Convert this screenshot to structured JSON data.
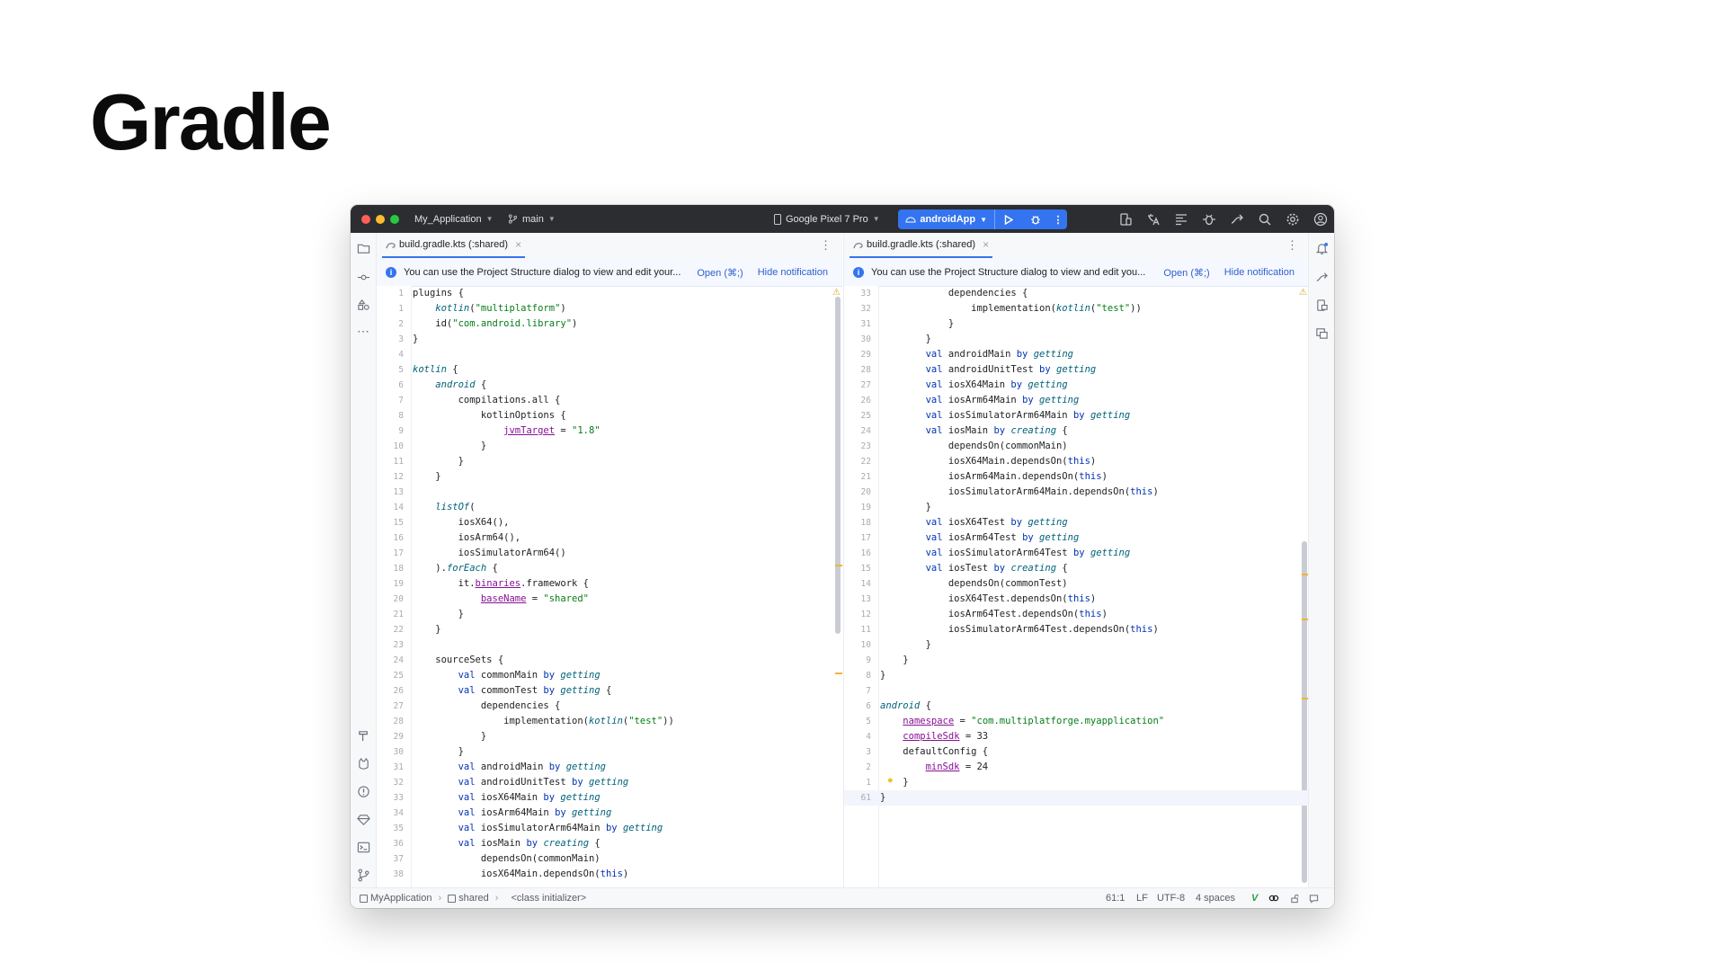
{
  "slide": {
    "title": "Gradle"
  },
  "titlebar": {
    "project": "My_Application",
    "branch": "main",
    "device": "Google Pixel 7 Pro",
    "run_config": "androidApp"
  },
  "left_pane": {
    "tab_label": "build.gradle.kts (:shared)",
    "notification": "You can use the Project Structure dialog to view and edit your...",
    "notification_open": "Open (⌘;)",
    "notification_hide": "Hide notification",
    "lines": [
      {
        "n": "1",
        "t": "plugins {"
      },
      {
        "n": "1",
        "t": "    kotlin(\"multiplatform\")"
      },
      {
        "n": "2",
        "t": "    id(\"com.android.library\")"
      },
      {
        "n": "3",
        "t": "}"
      },
      {
        "n": "4",
        "t": ""
      },
      {
        "n": "5",
        "t": "kotlin {"
      },
      {
        "n": "6",
        "t": "    android {"
      },
      {
        "n": "7",
        "t": "        compilations.all {"
      },
      {
        "n": "8",
        "t": "            kotlinOptions {"
      },
      {
        "n": "9",
        "t": "                jvmTarget = \"1.8\""
      },
      {
        "n": "10",
        "t": "            }"
      },
      {
        "n": "11",
        "t": "        }"
      },
      {
        "n": "12",
        "t": "    }"
      },
      {
        "n": "13",
        "t": ""
      },
      {
        "n": "14",
        "t": "    listOf("
      },
      {
        "n": "15",
        "t": "        iosX64(),"
      },
      {
        "n": "16",
        "t": "        iosArm64(),"
      },
      {
        "n": "17",
        "t": "        iosSimulatorArm64()"
      },
      {
        "n": "18",
        "t": "    ).forEach {"
      },
      {
        "n": "19",
        "t": "        it.binaries.framework {"
      },
      {
        "n": "20",
        "t": "            baseName = \"shared\""
      },
      {
        "n": "21",
        "t": "        }"
      },
      {
        "n": "22",
        "t": "    }"
      },
      {
        "n": "23",
        "t": ""
      },
      {
        "n": "24",
        "t": "    sourceSets {"
      },
      {
        "n": "25",
        "t": "        val commonMain by getting"
      },
      {
        "n": "26",
        "t": "        val commonTest by getting {"
      },
      {
        "n": "27",
        "t": "            dependencies {"
      },
      {
        "n": "28",
        "t": "                implementation(kotlin(\"test\"))"
      },
      {
        "n": "29",
        "t": "            }"
      },
      {
        "n": "30",
        "t": "        }"
      },
      {
        "n": "31",
        "t": "        val androidMain by getting"
      },
      {
        "n": "32",
        "t": "        val androidUnitTest by getting"
      },
      {
        "n": "33",
        "t": "        val iosX64Main by getting"
      },
      {
        "n": "34",
        "t": "        val iosArm64Main by getting"
      },
      {
        "n": "35",
        "t": "        val iosSimulatorArm64Main by getting"
      },
      {
        "n": "36",
        "t": "        val iosMain by creating {"
      },
      {
        "n": "37",
        "t": "            dependsOn(commonMain)"
      },
      {
        "n": "38",
        "t": "            iosX64Main.dependsOn(this)"
      }
    ]
  },
  "right_pane": {
    "tab_label": "build.gradle.kts (:shared)",
    "notification": "You can use the Project Structure dialog to view and edit you...",
    "notification_open": "Open (⌘;)",
    "notification_hide": "Hide notification",
    "lines": [
      {
        "n": "33",
        "t": "            dependencies {"
      },
      {
        "n": "32",
        "t": "                implementation(kotlin(\"test\"))"
      },
      {
        "n": "31",
        "t": "            }"
      },
      {
        "n": "30",
        "t": "        }"
      },
      {
        "n": "29",
        "t": "        val androidMain by getting"
      },
      {
        "n": "28",
        "t": "        val androidUnitTest by getting"
      },
      {
        "n": "27",
        "t": "        val iosX64Main by getting"
      },
      {
        "n": "26",
        "t": "        val iosArm64Main by getting"
      },
      {
        "n": "25",
        "t": "        val iosSimulatorArm64Main by getting"
      },
      {
        "n": "24",
        "t": "        val iosMain by creating {"
      },
      {
        "n": "23",
        "t": "            dependsOn(commonMain)"
      },
      {
        "n": "22",
        "t": "            iosX64Main.dependsOn(this)"
      },
      {
        "n": "21",
        "t": "            iosArm64Main.dependsOn(this)"
      },
      {
        "n": "20",
        "t": "            iosSimulatorArm64Main.dependsOn(this)"
      },
      {
        "n": "19",
        "t": "        }"
      },
      {
        "n": "18",
        "t": "        val iosX64Test by getting"
      },
      {
        "n": "17",
        "t": "        val iosArm64Test by getting"
      },
      {
        "n": "16",
        "t": "        val iosSimulatorArm64Test by getting"
      },
      {
        "n": "15",
        "t": "        val iosTest by creating {"
      },
      {
        "n": "14",
        "t": "            dependsOn(commonTest)"
      },
      {
        "n": "13",
        "t": "            iosX64Test.dependsOn(this)"
      },
      {
        "n": "12",
        "t": "            iosArm64Test.dependsOn(this)"
      },
      {
        "n": "11",
        "t": "            iosSimulatorArm64Test.dependsOn(this)"
      },
      {
        "n": "10",
        "t": "        }"
      },
      {
        "n": "9",
        "t": "    }"
      },
      {
        "n": "8",
        "t": "}"
      },
      {
        "n": "7",
        "t": ""
      },
      {
        "n": "6",
        "t": "android {"
      },
      {
        "n": "5",
        "t": "    namespace = \"com.multiplatforge.myapplication\""
      },
      {
        "n": "4",
        "t": "    compileSdk = 33"
      },
      {
        "n": "3",
        "t": "    defaultConfig {"
      },
      {
        "n": "2",
        "t": "        minSdk = 24"
      },
      {
        "n": "1",
        "t": "    }"
      },
      {
        "n": "61",
        "t": "}"
      }
    ]
  },
  "statusbar": {
    "breadcrumb": [
      "MyApplication",
      "shared",
      "<class initializer>"
    ],
    "position": "61:1",
    "line_separator": "LF",
    "encoding": "UTF-8",
    "indent": "4 spaces"
  },
  "colors": {
    "keyword": "#0033b3",
    "string": "#067d17",
    "function_call": "#00627a",
    "property": "#871094",
    "accent": "#3574f0"
  }
}
